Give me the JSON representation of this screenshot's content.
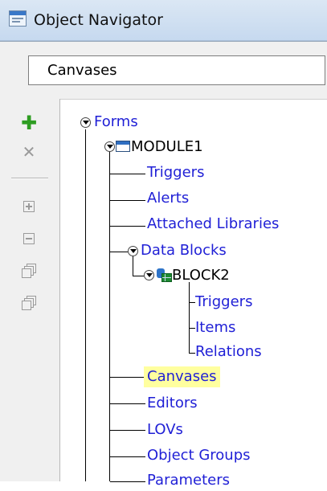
{
  "window": {
    "title": "Object Navigator"
  },
  "context_dropdown": {
    "value": "Canvases"
  },
  "toolbar": {
    "add_glyph": "✚",
    "delete_glyph": "✕",
    "buttons": [
      "create-icon",
      "delete-icon",
      "expand-icon",
      "collapse-icon",
      "expand-all-icon",
      "collapse-all-icon"
    ]
  },
  "tree": {
    "forms": "Forms",
    "module": "MODULE1",
    "module_children": {
      "triggers": "Triggers",
      "alerts": "Alerts",
      "attached_libraries": "Attached Libraries",
      "data_blocks": "Data Blocks"
    },
    "block": "BLOCK2",
    "block_children": {
      "triggers": "Triggers",
      "items": "Items",
      "relations": "Relations"
    },
    "after_blocks": {
      "canvases": "Canvases",
      "editors": "Editors",
      "lovs": "LOVs",
      "object_groups": "Object Groups",
      "parameters": "Parameters"
    }
  },
  "colors": {
    "node_link": "#1f1fd6",
    "selected_highlight": "#ffff9f",
    "add_button": "#2e9d22"
  }
}
